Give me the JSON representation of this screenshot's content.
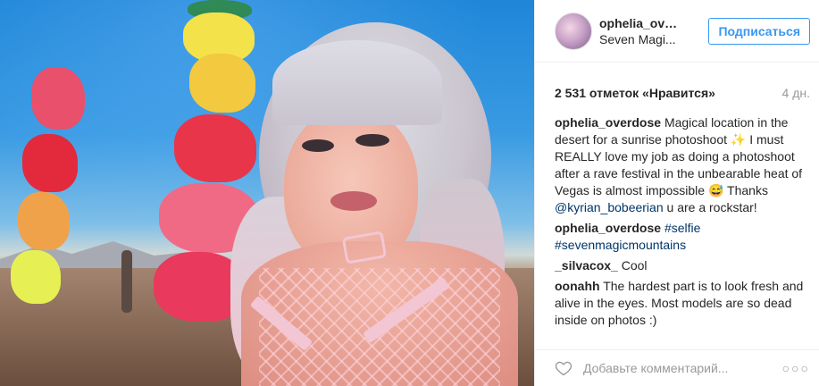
{
  "header": {
    "username": "ophelia_over...",
    "location": "Seven Magi...",
    "follow_label": "Подписаться"
  },
  "stats": {
    "likes_text": "2 531 отметок «Нравится»",
    "time_ago": "4 дн."
  },
  "comments": [
    {
      "user": "ophelia_overdose",
      "text": "Magical location in the desert for a sunrise photoshoot ✨ I must REALLY love my job as doing a photoshoot after a rave festival in the unbearable heat of Vegas is almost impossible 😅 Thanks",
      "mention": "@kyrian_bobeerian",
      "text_after": "u are a rockstar!"
    },
    {
      "user": "ophelia_overdose",
      "tags": [
        "#selfie",
        "#sevenmagicmountains"
      ]
    },
    {
      "user": "_silvacox_",
      "text": "Cool"
    },
    {
      "user": "oonahh",
      "text": "The hardest part is to look fresh and alive in the eyes. Most models are so dead inside on photos :)"
    }
  ],
  "add_comment": {
    "placeholder": "Добавьте комментарий...",
    "more_icon": "ellipsis-icon",
    "like_icon": "heart-icon"
  },
  "colors": {
    "accent": "#3897f0",
    "link": "#003569",
    "muted": "#999999",
    "border": "#efefef"
  }
}
